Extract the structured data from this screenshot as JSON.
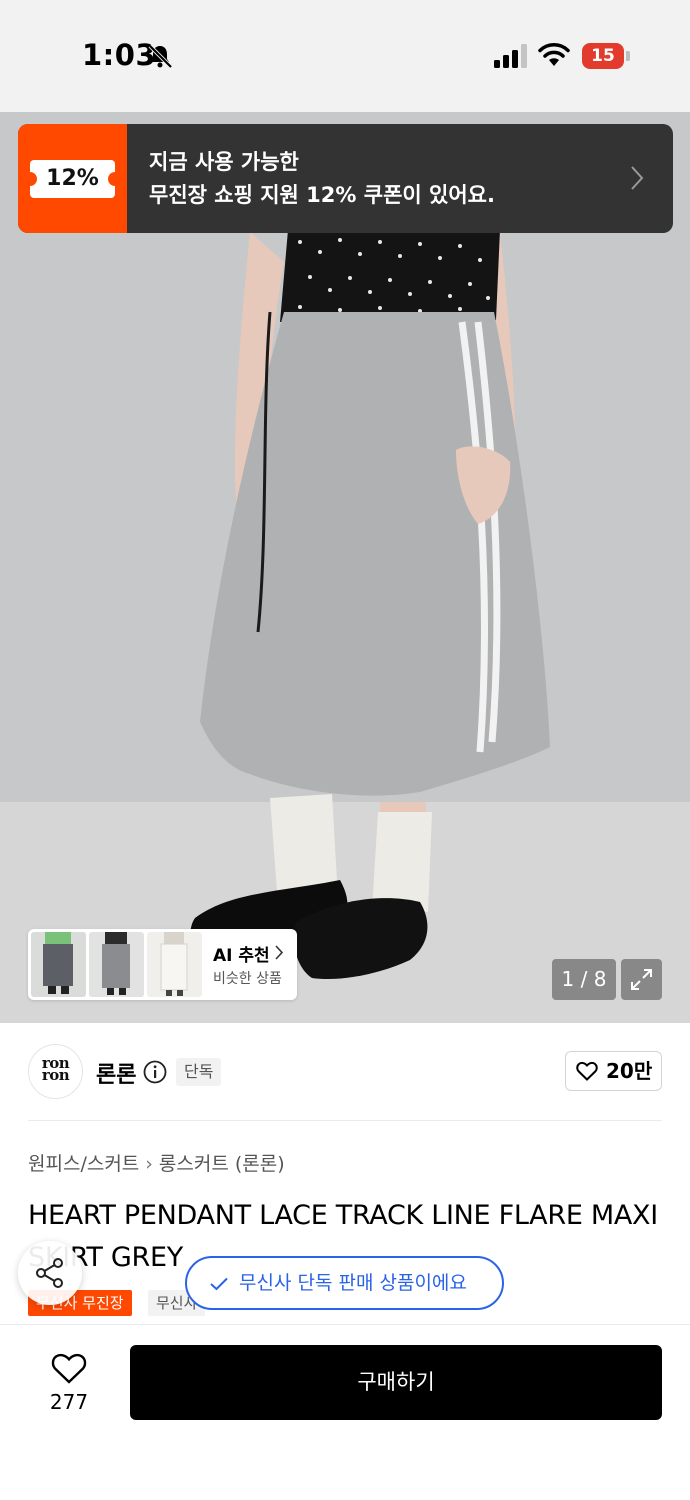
{
  "status_bar": {
    "time": "1:03",
    "battery_level": "15"
  },
  "coupon_banner": {
    "badge": "12%",
    "line1": "지금 사용 가능한",
    "line2": "무진장 쇼핑 지원 12% 쿠폰이 있어요."
  },
  "similar_items": {
    "title": "AI 추천",
    "subtitle": "비슷한 상품"
  },
  "image_viewer": {
    "counter": "1 / 8"
  },
  "brand": {
    "logo_line1": "ron",
    "logo_line2": "ron",
    "name": "론론",
    "exclusive_label": "단독",
    "like_count": "20만"
  },
  "breadcrumb": {
    "category": "원피스/스커트",
    "subcategory": "롱스커트 (론론)"
  },
  "product": {
    "title": "HEART PENDANT LACE TRACK LINE FLARE MAXI SKIRT GREY",
    "tags": [
      "무신사 무진장",
      "무신사"
    ]
  },
  "toast": {
    "message": "무신사 단독 판매 상품이에요"
  },
  "bottom_bar": {
    "wish_count": "277",
    "buy_label": "구매하기"
  },
  "colors": {
    "brand_accent": "#ff4800",
    "toast_blue": "#2a63e8",
    "banner_bg": "#333333",
    "buy_button_bg": "#000000"
  }
}
